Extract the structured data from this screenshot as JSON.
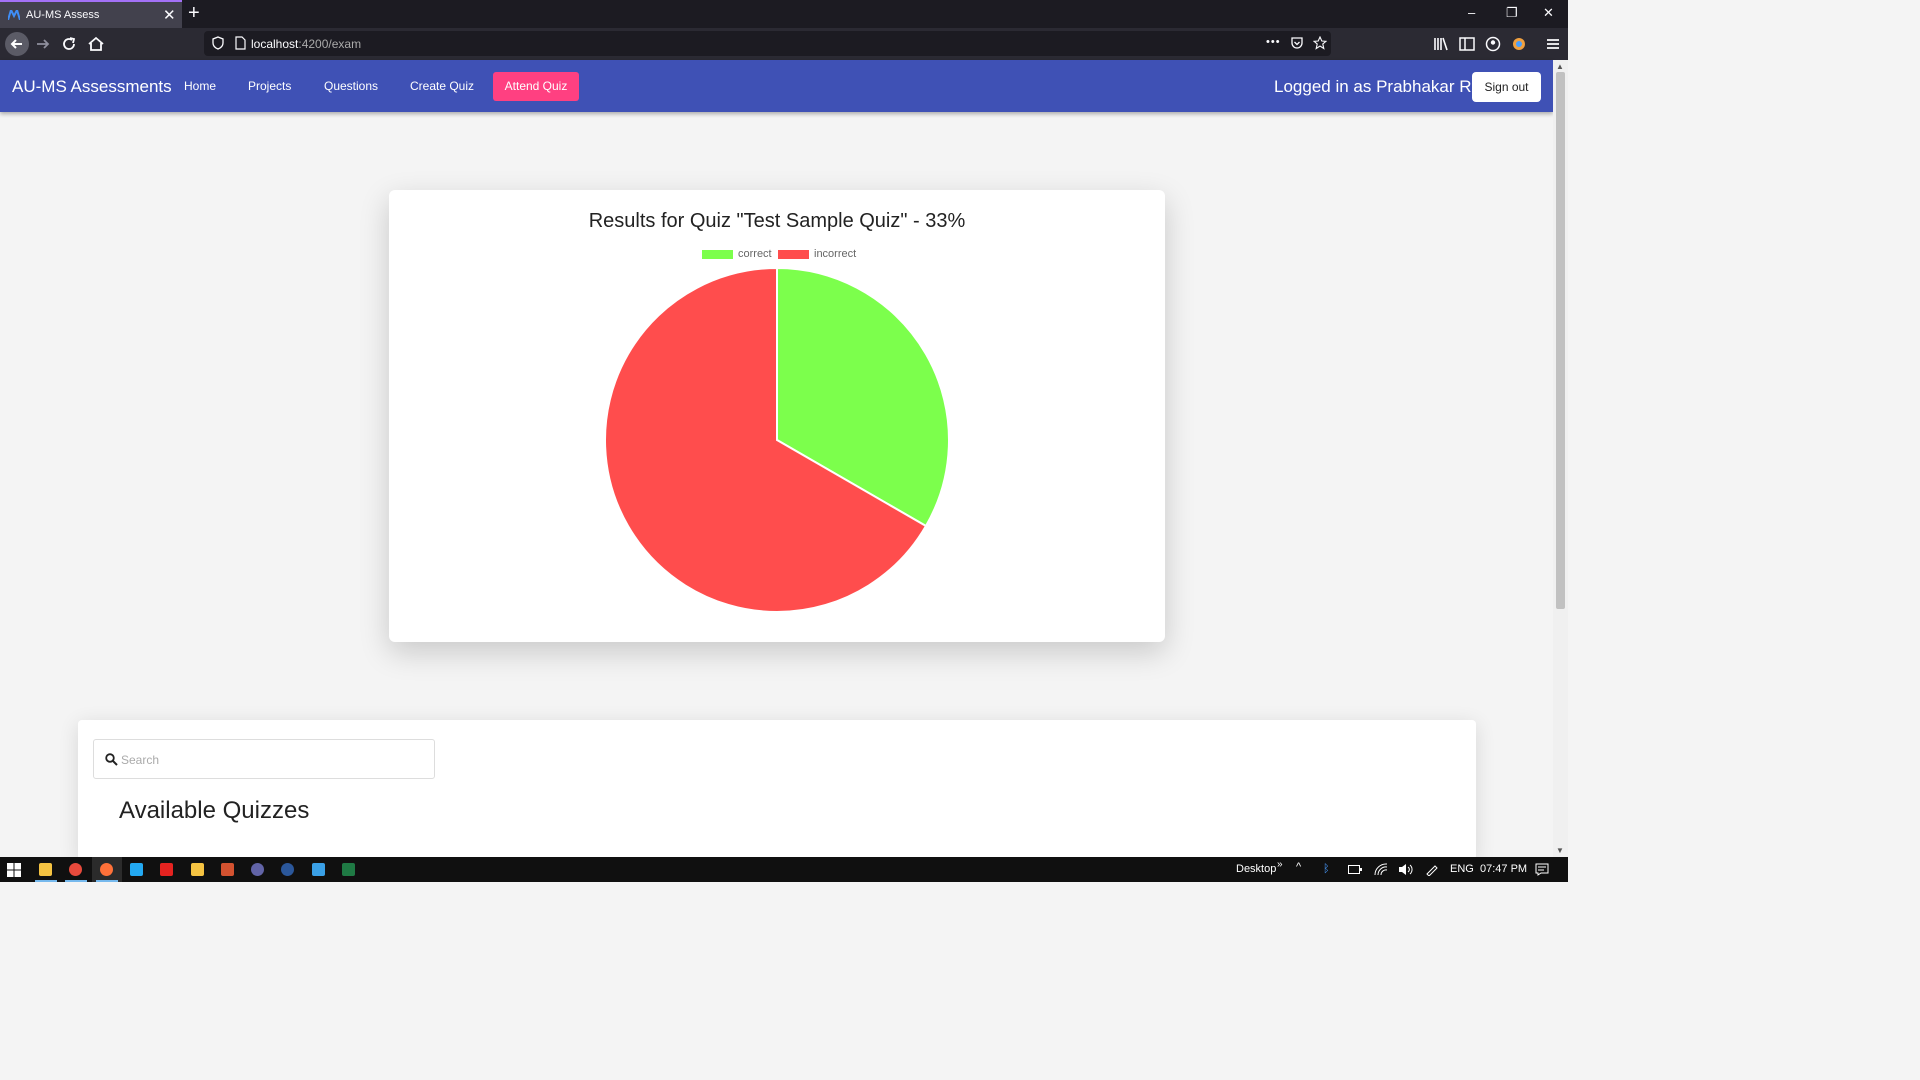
{
  "browser": {
    "tab_title": "AU-MS Assess",
    "close_tab_glyph": "✕",
    "new_tab_glyph": "+",
    "url_host": "localhost",
    "url_path": ":4200/exam",
    "more_glyph": "•••",
    "window_controls": {
      "minimize": "–",
      "restore": "❐",
      "close": "✕"
    }
  },
  "app": {
    "brand": "AU-MS Assessments",
    "nav": {
      "home": "Home",
      "projects": "Projects",
      "questions": "Questions",
      "create_quiz": "Create Quiz",
      "attend_quiz": "Attend Quiz"
    },
    "logged_in_text": "Logged in as Prabhakar R",
    "sign_out": "Sign out",
    "colors": {
      "toolbar": "#3f51b5",
      "accent": "#ff4081"
    }
  },
  "chart_data": {
    "type": "pie",
    "title": "Results for Quiz \"Test Sample Quiz\" - 33%",
    "labels": [
      "correct",
      "incorrect"
    ],
    "values": [
      1,
      2
    ],
    "colors": [
      "#7cff4c",
      "#ff4d4d"
    ],
    "legend": "top",
    "start_angle": "12 o'clock, clockwise"
  },
  "quizzes": {
    "search_placeholder": "Search",
    "search_value": "",
    "title": "Available Quizzes"
  },
  "taskbar": {
    "apps": [
      "file-explorer-icon",
      "chrome-icon",
      "firefox-icon",
      "vscode-icon",
      "acrobat-icon",
      "folder-icon",
      "powerpoint-icon",
      "teams-icon",
      "word-icon",
      "notepad-icon",
      "excel-icon"
    ],
    "desktop_label": "Desktop",
    "desktop_chevron": "»",
    "language": "ENG",
    "time": "07:47 PM"
  }
}
